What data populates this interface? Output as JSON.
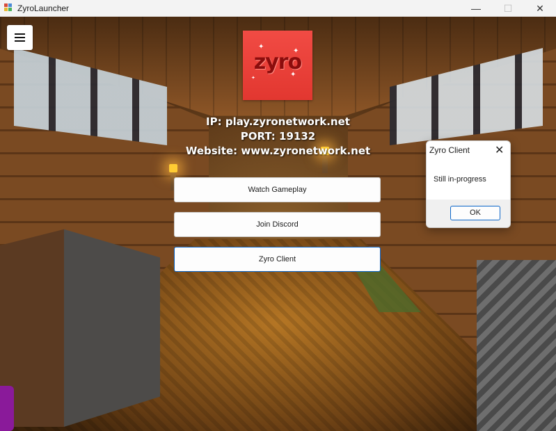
{
  "window": {
    "title": "ZyroLauncher",
    "controls": {
      "minimize": "—",
      "maximize": "☐",
      "close": "✕"
    }
  },
  "logo": {
    "text": "zyro",
    "color": "#ef4136"
  },
  "server": {
    "ip": "IP: play.zyronetwork.net",
    "port": "PORT: 19132",
    "website": "Website: www.zyronetwork.net"
  },
  "buttons": {
    "watch": "Watch Gameplay",
    "discord": "Join Discord",
    "client": "Zyro Client"
  },
  "dialog": {
    "title": "Zyro Client",
    "close": "✕",
    "message": "Still in-progress",
    "ok": "OK"
  },
  "icons": {
    "menu": "hamburger-menu-icon",
    "app": "windows-app-icon"
  },
  "colors": {
    "focus_border": "#0a64c8",
    "logo_bg": "#ef4136"
  }
}
